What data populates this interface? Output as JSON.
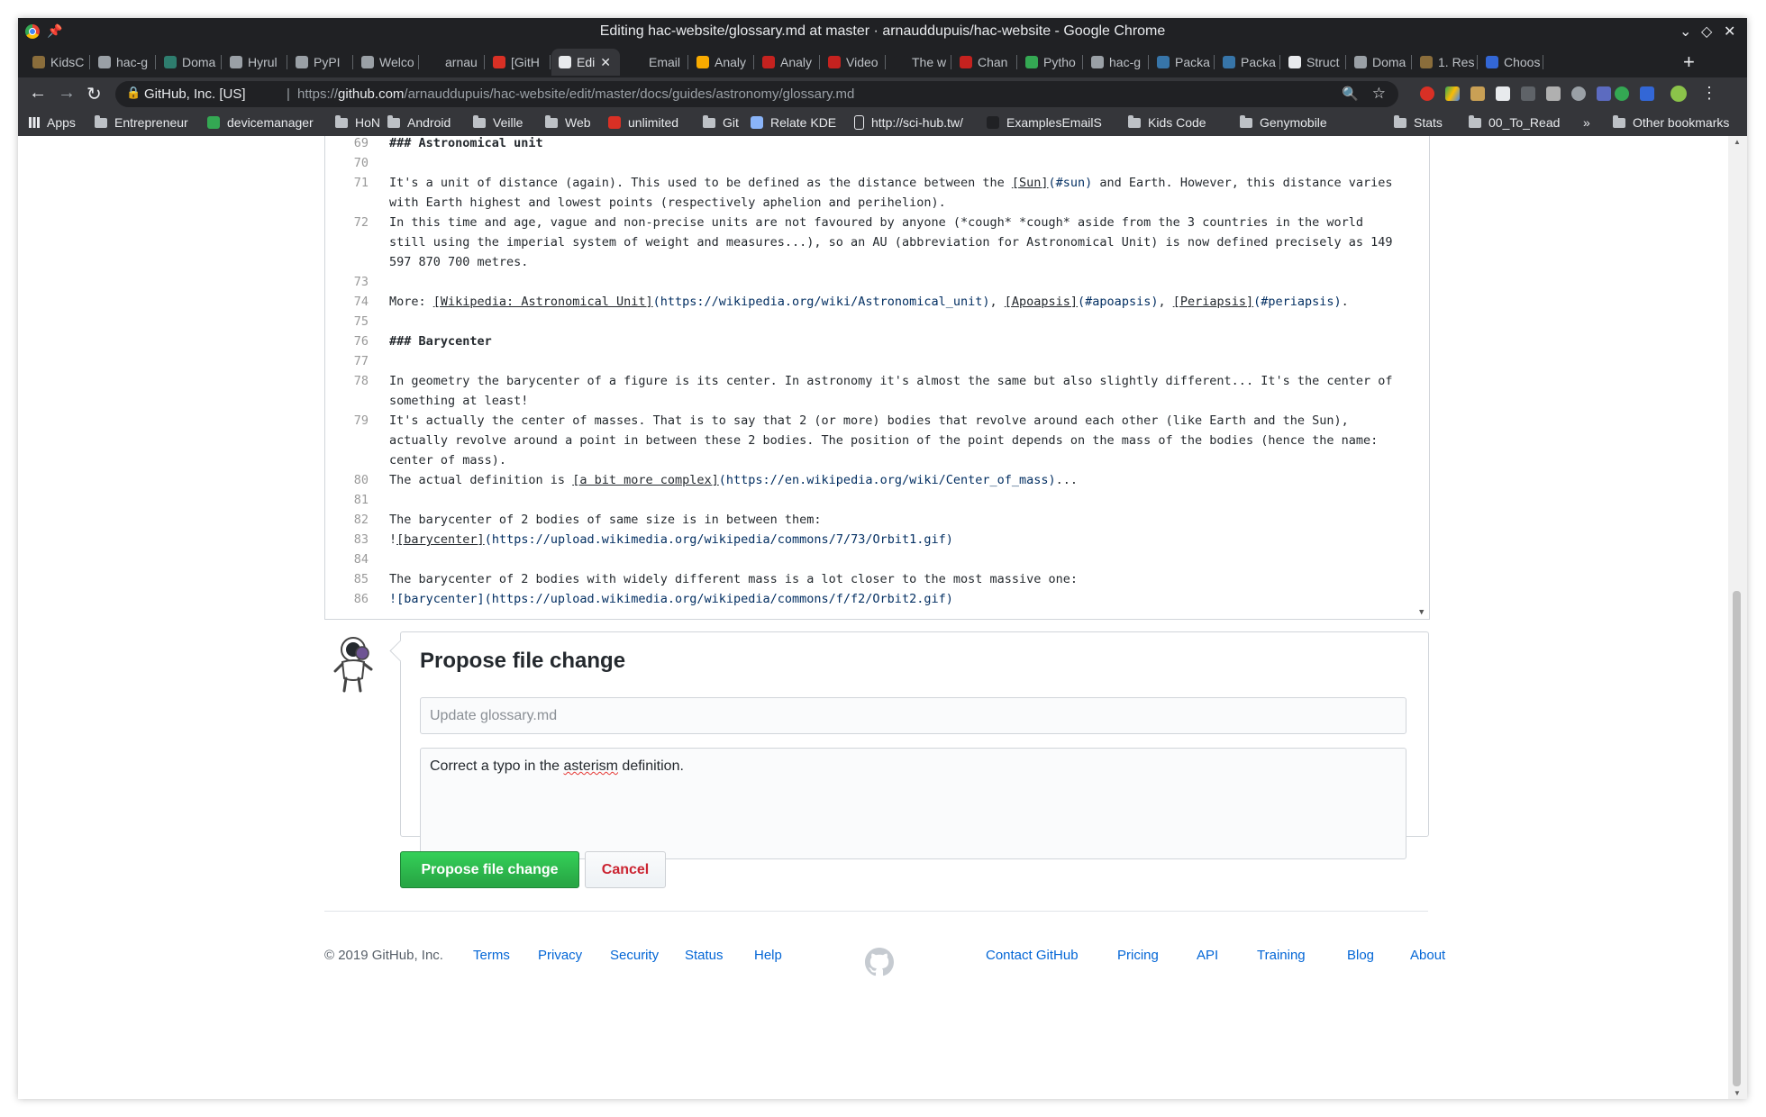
{
  "window": {
    "title": "Editing hac-website/glossary.md at master · arnauddupuis/hac-website - Google Chrome"
  },
  "tabs": [
    {
      "label": "KidsC",
      "color": "#8a6d3b"
    },
    {
      "label": "hac-g",
      "color": "#9aa0a6"
    },
    {
      "label": "Doma",
      "color": "#2e7d6e"
    },
    {
      "label": "Hyrul",
      "color": "#9aa0a6"
    },
    {
      "label": "PyPI",
      "color": "#9aa0a6"
    },
    {
      "label": "Welco",
      "color": "#9aa0a6"
    },
    {
      "label": "arnau",
      "color": "#202124"
    },
    {
      "label": "[GitH",
      "color": "#d93025"
    },
    {
      "label": "Edi",
      "color": "#e8eaed",
      "active": true
    },
    {
      "label": "Email",
      "color": "#202124"
    },
    {
      "label": "Analy",
      "color": "#f9ab00"
    },
    {
      "label": "Analy",
      "color": "#c5221f"
    },
    {
      "label": "Video",
      "color": "#c5221f"
    },
    {
      "label": "The w",
      "color": "#202124"
    },
    {
      "label": "Chan",
      "color": "#c5221f"
    },
    {
      "label": "Pytho",
      "color": "#34a853"
    },
    {
      "label": "hac-g",
      "color": "#9aa0a6"
    },
    {
      "label": "Packa",
      "color": "#3775a9"
    },
    {
      "label": "Packa",
      "color": "#3775a9"
    },
    {
      "label": "Struct",
      "color": "#e8eaed"
    },
    {
      "label": "Doma",
      "color": "#9aa0a6"
    },
    {
      "label": "1. Res",
      "color": "#8a6d3b"
    },
    {
      "label": "Choos",
      "color": "#3367d6"
    }
  ],
  "omnibox": {
    "secure_label": "GitHub, Inc. [US]",
    "separator": "|",
    "url_prefix": "https://",
    "url_host": "github.com",
    "url_path": "/arnauddupuis/hac-website/edit/master/docs/guides/astronomy/glossary.md"
  },
  "bookmarks": {
    "apps": "Apps",
    "items": [
      {
        "label": "Entrepreneur",
        "kind": "folder"
      },
      {
        "label": "devicemanager",
        "kind": "site",
        "color": "#34a853"
      },
      {
        "label": "HoN",
        "kind": "folder"
      },
      {
        "label": "Android",
        "kind": "folder"
      },
      {
        "label": "Veille",
        "kind": "folder"
      },
      {
        "label": "Web",
        "kind": "folder"
      },
      {
        "label": "unlimited",
        "kind": "site",
        "color": "#d93025"
      },
      {
        "label": "Git",
        "kind": "folder"
      },
      {
        "label": "Relate KDE",
        "kind": "site",
        "color": "#8ab4f8"
      },
      {
        "label": "http://sci-hub.tw/",
        "kind": "page"
      },
      {
        "label": "ExamplesEmailS",
        "kind": "site",
        "color": "#202124"
      },
      {
        "label": "Kids Code",
        "kind": "folder"
      },
      {
        "label": "Genymobile",
        "kind": "folder"
      },
      {
        "label": "Stats",
        "kind": "folder"
      },
      {
        "label": "00_To_Read",
        "kind": "folder"
      }
    ],
    "more": "»",
    "other": "Other bookmarks"
  },
  "editor": {
    "lines": [
      {
        "n": "69",
        "parts": [
          {
            "t": "### Astronomical unit",
            "c": "hd"
          }
        ]
      },
      {
        "n": "70",
        "parts": []
      },
      {
        "n": "71",
        "parts": [
          {
            "t": "It's a unit of distance (again). This used to be defined as the distance between the "
          },
          {
            "t": "[Sun]",
            "c": "u"
          },
          {
            "t": "(#sun)",
            "c": "lk"
          },
          {
            "t": " and Earth. However, this distance varies"
          }
        ]
      },
      {
        "n": "",
        "parts": [
          {
            "t": "with Earth highest and lowest points (respectively aphelion and perihelion)."
          }
        ]
      },
      {
        "n": "72",
        "parts": [
          {
            "t": "In this time and age, vague and non-precise units are not favoured by anyone ("
          },
          {
            "t": "*cough* *cough*",
            "c": "it"
          },
          {
            "t": " aside from the 3 countries in the world"
          }
        ]
      },
      {
        "n": "",
        "parts": [
          {
            "t": "still using the imperial system of weight and measures...), so an AU (abbreviation for Astronomical Unit) is now defined precisely as 149"
          }
        ]
      },
      {
        "n": "",
        "parts": [
          {
            "t": "597 870 700 metres."
          }
        ]
      },
      {
        "n": "73",
        "parts": []
      },
      {
        "n": "74",
        "parts": [
          {
            "t": "More: "
          },
          {
            "t": "[Wikipedia: Astronomical Unit]",
            "c": "u"
          },
          {
            "t": "(https://wikipedia.org/wiki/Astronomical_unit)",
            "c": "lk"
          },
          {
            "t": ", "
          },
          {
            "t": "[Apoapsis]",
            "c": "u"
          },
          {
            "t": "(#apoapsis)",
            "c": "lk"
          },
          {
            "t": ", "
          },
          {
            "t": "[Periapsis]",
            "c": "u"
          },
          {
            "t": "(#periapsis)",
            "c": "lk"
          },
          {
            "t": "."
          }
        ]
      },
      {
        "n": "75",
        "parts": []
      },
      {
        "n": "76",
        "parts": [
          {
            "t": "### Barycenter",
            "c": "hd"
          }
        ]
      },
      {
        "n": "77",
        "parts": []
      },
      {
        "n": "78",
        "parts": [
          {
            "t": "In geometry the barycenter of a figure is its center. In astronomy it's almost the same but also slightly different... It's the center of"
          }
        ]
      },
      {
        "n": "",
        "parts": [
          {
            "t": "something at least!"
          }
        ]
      },
      {
        "n": "79",
        "parts": [
          {
            "t": "It's actually the center of masses. That is to say that 2 (or more) bodies that revolve around each other (like Earth and the Sun),"
          }
        ]
      },
      {
        "n": "",
        "parts": [
          {
            "t": "actually revolve around a point in between these 2 bodies. The position of the point depends on the mass of the bodies (hence the name:"
          }
        ]
      },
      {
        "n": "",
        "parts": [
          {
            "t": "center of mass)."
          }
        ]
      },
      {
        "n": "80",
        "parts": [
          {
            "t": "The actual definition is "
          },
          {
            "t": "[a bit more complex]",
            "c": "u"
          },
          {
            "t": "(https://en.wikipedia.org/wiki/Center_of_mass)",
            "c": "lk"
          },
          {
            "t": "..."
          }
        ]
      },
      {
        "n": "81",
        "parts": []
      },
      {
        "n": "82",
        "parts": [
          {
            "t": "The barycenter of 2 bodies of same size is in between them:"
          }
        ]
      },
      {
        "n": "83",
        "parts": [
          {
            "t": "!"
          },
          {
            "t": "[barycenter]",
            "c": "u"
          },
          {
            "t": "(https://upload.wikimedia.org/wikipedia/commons/7/73/Orbit1.gif)",
            "c": "lk"
          }
        ]
      },
      {
        "n": "84",
        "parts": []
      },
      {
        "n": "85",
        "parts": [
          {
            "t": "The barycenter of 2 bodies with widely different mass is a lot closer to the most massive one:"
          }
        ]
      },
      {
        "n": "86",
        "parts": [
          {
            "t": "![barycenter](https://upload.wikimedia.org/wikipedia/commons/f/f2/Orbit2.gif)",
            "c": "lk"
          }
        ]
      }
    ]
  },
  "commit": {
    "heading": "Propose file change",
    "summary_placeholder": "Update glossary.md",
    "summary_value": "",
    "description_before": "Correct a typo in the ",
    "description_misspelled": "asterism",
    "description_after": " definition.",
    "propose_button": "Propose file change",
    "cancel_button": "Cancel"
  },
  "footer": {
    "copyright": "© 2019 GitHub, Inc.",
    "left_links": [
      "Terms",
      "Privacy",
      "Security",
      "Status",
      "Help"
    ],
    "right_links": [
      "Contact GitHub",
      "Pricing",
      "API",
      "Training",
      "Blog",
      "About"
    ]
  }
}
